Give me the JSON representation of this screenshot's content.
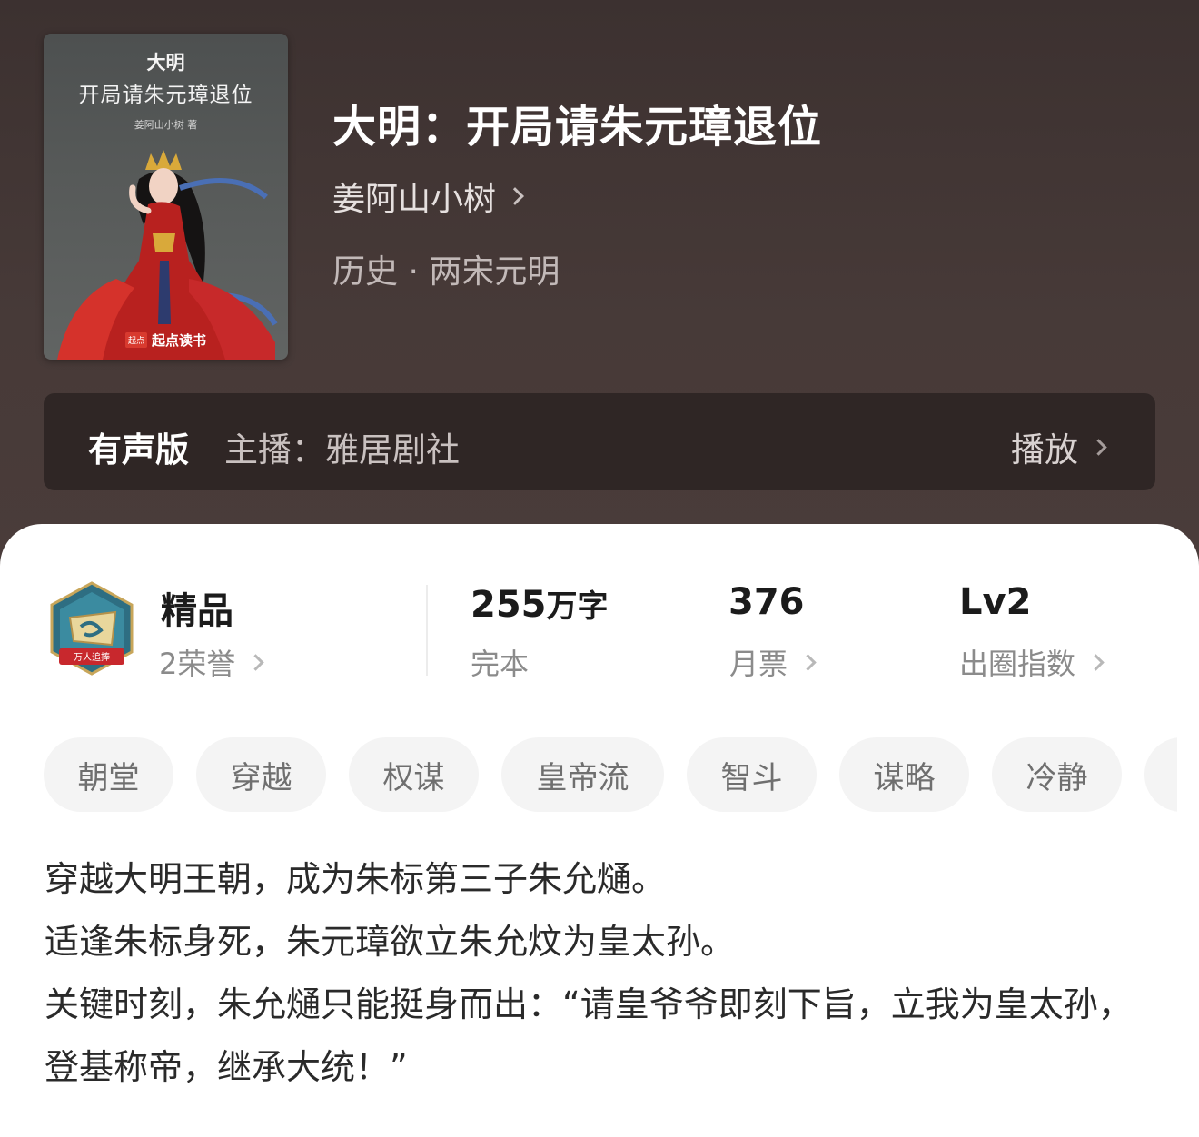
{
  "cover": {
    "title_line1": "大明",
    "title_line2": "开局请朱元璋退位",
    "author_credit": "姜阿山小树 著",
    "publisher_badge": "起点",
    "publisher": "起点读书"
  },
  "book": {
    "title": "大明：开局请朱元璋退位",
    "author": "姜阿山小树",
    "category": "历史 · 两宋元明"
  },
  "audio": {
    "label": "有声版",
    "host": "主播：雅居剧社",
    "play": "播放"
  },
  "stats": {
    "badge_text": "万人追捧",
    "quality": {
      "title": "精品",
      "sub": "2荣誉"
    },
    "words": {
      "value": "255",
      "unit": "万字",
      "sub": "完本"
    },
    "tickets": {
      "value": "376",
      "sub": "月票"
    },
    "influence": {
      "value": "Lv2",
      "sub": "出圈指数"
    }
  },
  "tags": [
    "朝堂",
    "穿越",
    "权谋",
    "皇帝流",
    "智斗",
    "谋略",
    "冷静"
  ],
  "description": [
    "穿越大明王朝，成为朱标第三子朱允熥。",
    "适逢朱标身死，朱元璋欲立朱允炆为皇太孙。",
    "关键时刻，朱允熥只能挺身而出：“请皇爷爷即刻下旨，立我为皇太孙，登基称帝，继承大统！”"
  ],
  "colors": {
    "header_bg": "#443836",
    "audio_bar_bg": "#2f2625",
    "tag_bg": "#f4f4f4",
    "badge_red": "#c8282d",
    "badge_teal": "#2e6e82"
  }
}
